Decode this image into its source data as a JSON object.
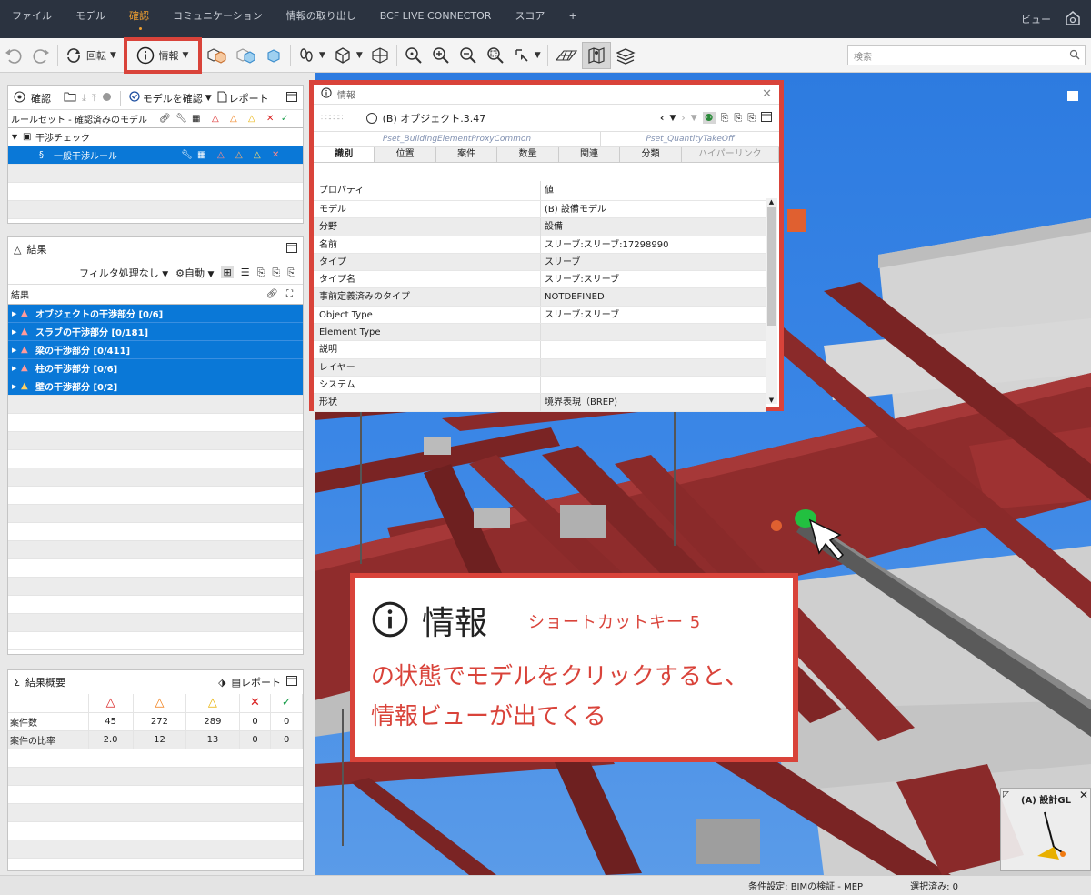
{
  "menubar": {
    "items": [
      "ファイル",
      "モデル",
      "確認",
      "コミュニケーション",
      "情報の取り出し",
      "BCF LIVE CONNECTOR",
      "スコア",
      "+"
    ],
    "active_index": 2,
    "right_label": "ビュー"
  },
  "toolbar": {
    "rotate_label": "回転",
    "info_label": "情報",
    "search_placeholder": "検索"
  },
  "check_panel": {
    "title": "確認",
    "verify_label": "モデルを確認",
    "report_label": "レポート",
    "column_label": "ルールセット - 確認済みのモデル",
    "items": [
      {
        "label": "干渉チェック",
        "selected": false
      },
      {
        "label": "一般干渉ルール",
        "selected": true
      }
    ]
  },
  "results_panel": {
    "title": "結果",
    "filter_label": "フィルタ処理なし",
    "auto_label": "自動",
    "column_label": "結果",
    "items": [
      "オブジェクトの干渉部分 [0/6]",
      "スラブの干渉部分 [0/181]",
      "梁の干渉部分 [0/411]",
      "柱の干渉部分 [0/6]",
      "壁の干渉部分 [0/2]"
    ]
  },
  "summary_panel": {
    "title": "結果概要",
    "report_label": "レポート",
    "rows": [
      {
        "label": "案件数",
        "values": [
          "45",
          "272",
          "289",
          "0",
          "0"
        ]
      },
      {
        "label": "案件の比率",
        "values": [
          "2.0",
          "12",
          "13",
          "0",
          "0"
        ]
      }
    ]
  },
  "info_window": {
    "title": "情報",
    "object_label": "(B) オブジェクト.3.47",
    "upper_tabs": [
      "Pset_BuildingElementProxyCommon",
      "Pset_QuantityTakeOff"
    ],
    "tabs": [
      "識別",
      "位置",
      "案件",
      "数量",
      "関連",
      "分類",
      "ハイパーリンク"
    ],
    "active_tab": 0,
    "header": {
      "key": "プロパティ",
      "value": "値"
    },
    "properties": [
      {
        "key": "モデル",
        "value": "(B) 設備モデル"
      },
      {
        "key": "分野",
        "value": "設備"
      },
      {
        "key": "名前",
        "value": "スリーブ:スリーブ:17298990"
      },
      {
        "key": "タイプ",
        "value": "スリーブ"
      },
      {
        "key": "タイプ名",
        "value": "スリーブ:スリーブ"
      },
      {
        "key": "事前定義済みのタイプ",
        "value": "NOTDEFINED"
      },
      {
        "key": "Object Type",
        "value": "スリーブ:スリーブ"
      },
      {
        "key": "Element Type",
        "value": ""
      },
      {
        "key": "説明",
        "value": ""
      },
      {
        "key": "レイヤー",
        "value": ""
      },
      {
        "key": "システム",
        "value": ""
      },
      {
        "key": "形状",
        "value": "境界表現（BREP)"
      }
    ]
  },
  "callout": {
    "title": "情報",
    "shortcut": "ショートカットキー 5",
    "line1": "の状態でモデルをクリックすると、",
    "line2": "情報ビューが出てくる"
  },
  "viewport": {
    "navcube_label": "(A) 設計GL"
  },
  "status": {
    "condition": "条件設定: BIMの検証 - MEP",
    "selected": "選択済み: 0"
  },
  "colors": {
    "accent_red": "#d9433a",
    "selection_blue": "#0a78d7",
    "menubar_bg": "#2b3340",
    "active_menu": "#f0a030"
  }
}
